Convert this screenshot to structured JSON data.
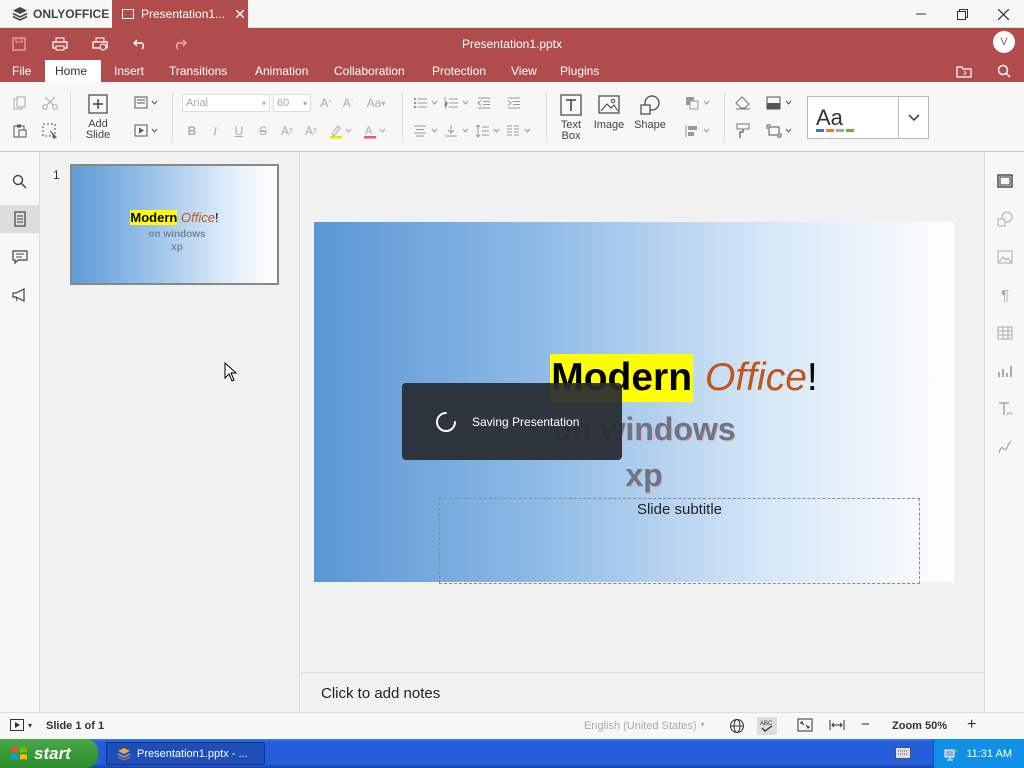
{
  "app": {
    "brand": "ONLYOFFICE",
    "tab_title": "Presentation1....",
    "window_title": "Presentation1.pptx",
    "user_initial": "V"
  },
  "menu": {
    "items": [
      "File",
      "Home",
      "Insert",
      "Transitions",
      "Animation",
      "Collaboration",
      "Protection",
      "View",
      "Plugins"
    ],
    "active": "Home"
  },
  "toolbar": {
    "add_slide_label1": "Add",
    "add_slide_label2": "Slide",
    "font_name": "Arial",
    "font_size": "60",
    "text_box_label1": "Text",
    "text_box_label2": "Box",
    "image_label": "Image",
    "shape_label": "Shape",
    "theme_preview": "Aa"
  },
  "thumbnails": [
    {
      "number": "1",
      "title_highlight": "Modern",
      "title_italic": "Office",
      "title_end": "!",
      "line2": "on windows",
      "line3": "xp"
    }
  ],
  "slide": {
    "title_word1": "Modern",
    "title_word2": "Office",
    "title_end": "!",
    "subtitle_line1": "on windows",
    "subtitle_line2": "xp",
    "placeholder_subtitle": "Slide subtitle",
    "highlight_color": "#ffff00",
    "office_color": "#c0571a"
  },
  "toast": {
    "text": "Saving Presentation"
  },
  "notes": {
    "placeholder": "Click to add notes"
  },
  "status": {
    "slide_indicator": "Slide 1 of 1",
    "language": "English (United States)",
    "zoom": "Zoom 50%"
  },
  "taskbar": {
    "start_label": "start",
    "task_label": "Presentation1.pptx - ...",
    "clock": "11:31 AM"
  },
  "colors": {
    "accent": "#b14c4c",
    "taskbar": "#245edb"
  }
}
